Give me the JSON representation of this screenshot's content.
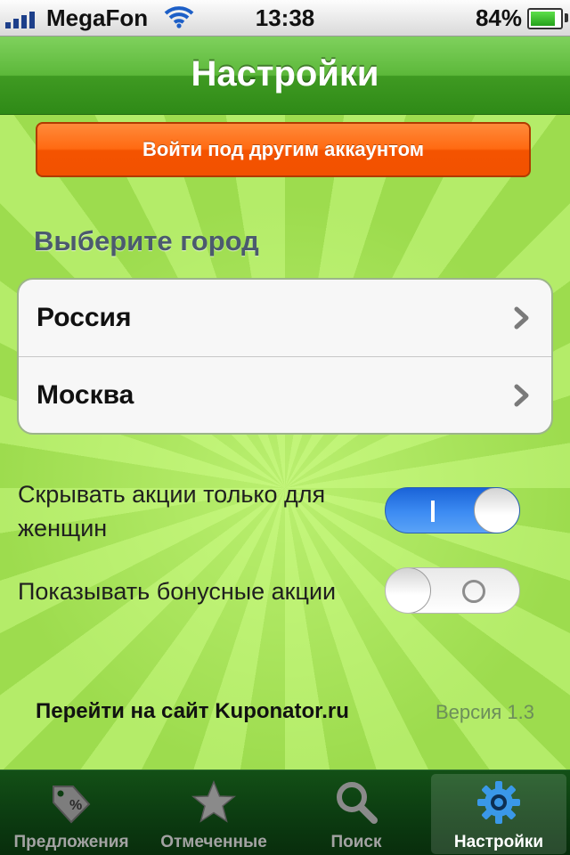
{
  "status_bar": {
    "carrier": "MegaFon",
    "time": "13:38",
    "battery_percent": "84%",
    "battery_level": 0.84,
    "signal_bars": 4,
    "signal_icon": "signal-bars-icon",
    "wifi_icon": "wifi-icon",
    "battery_icon": "battery-icon"
  },
  "nav": {
    "title": "Настройки"
  },
  "account": {
    "switch_label": "Войти под другим аккаунтом",
    "button_color": "#f25a00"
  },
  "city": {
    "header": "Выберите город",
    "rows": [
      {
        "label": "Россия",
        "icon": "chevron-right-icon"
      },
      {
        "label": "Москва",
        "icon": "chevron-right-icon"
      }
    ]
  },
  "toggles": [
    {
      "label": "Скрывать акции только для женщин",
      "state": "on"
    },
    {
      "label": "Показывать бонусные акции",
      "state": "off"
    }
  ],
  "footer": {
    "website_link": "Перейти на сайт Kuponator.ru",
    "version": "Версия 1.3"
  },
  "tabs": [
    {
      "label": "Предложения",
      "icon": "discount-tag-icon",
      "active": false
    },
    {
      "label": "Отмеченные",
      "icon": "star-icon",
      "active": false
    },
    {
      "label": "Поиск",
      "icon": "search-icon",
      "active": false
    },
    {
      "label": "Настройки",
      "icon": "gear-icon",
      "active": true
    }
  ],
  "colors": {
    "nav_green": "#4fae2e",
    "background_green": "#a8e55a",
    "switch_on_blue": "#2f7fec",
    "tab_bar": "#0c3d11",
    "accent_orange": "#f25a00"
  }
}
